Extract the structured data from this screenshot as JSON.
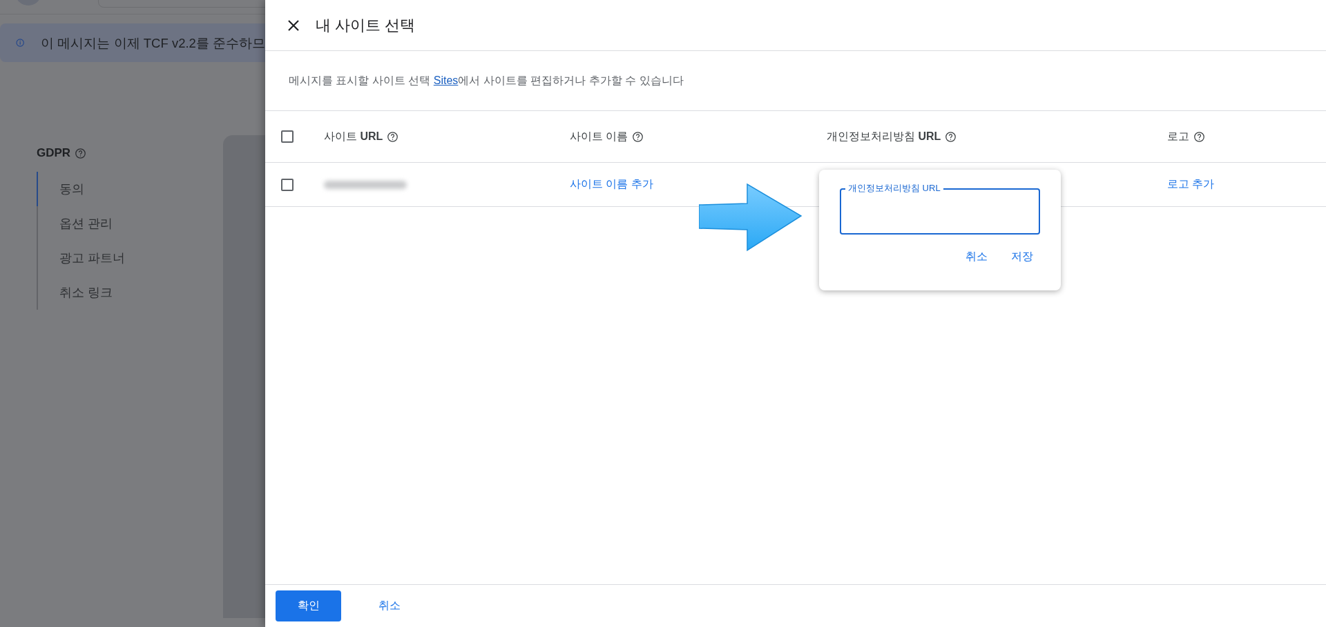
{
  "background_page": {
    "banner": {
      "text": "이 메시지는 이제 TCF v2.2를 준수하므"
    },
    "nav": {
      "title": "GDPR",
      "items": [
        {
          "label": "동의",
          "selected": true
        },
        {
          "label": "옵션 관리",
          "selected": false
        },
        {
          "label": "광고 파트너",
          "selected": false
        },
        {
          "label": "취소 링크",
          "selected": false
        }
      ]
    }
  },
  "dialog": {
    "title": "내 사이트 선택",
    "description": [
      {
        "kind": "text",
        "text": "메시지를 표시할 사이트 선택 "
      },
      {
        "kind": "link",
        "text": "Sites"
      },
      {
        "kind": "text",
        "text": "에서 사이트를 편집하거나 추가할 수 있습니다"
      }
    ],
    "table": {
      "select_all_checked": false,
      "columns": [
        {
          "label": "사이트 **URL**"
        },
        {
          "label": "사이트 이름"
        },
        {
          "label": "개인정보처리방침 **URL**"
        },
        {
          "label": "로고"
        }
      ],
      "rows": [
        {
          "checked": false,
          "site_name": "사이트 이름 추가",
          "logo": "로고 추가"
        }
      ]
    },
    "popup": {
      "field_label": "개인정보처리방침 URL",
      "focused": true,
      "buttons": [
        "취소",
        "저장"
      ]
    },
    "footer": {
      "buttons": [
        {
          "label": "확인",
          "kind": "primary"
        },
        {
          "label": "취소",
          "kind": "text"
        }
      ]
    }
  }
}
